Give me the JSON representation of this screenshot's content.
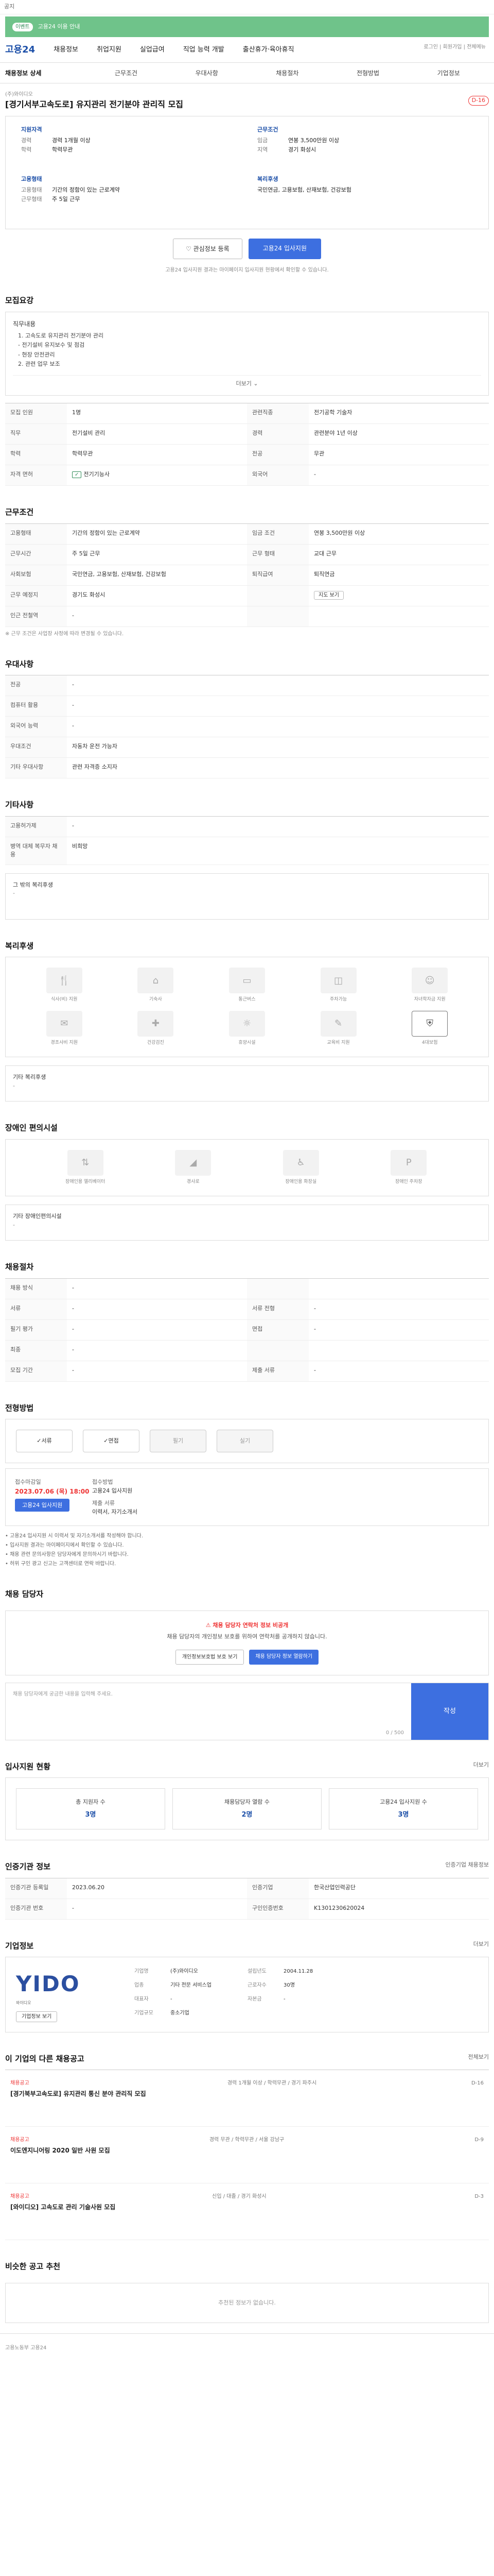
{
  "topbar": {
    "text": "공지"
  },
  "banner": {
    "tag": "이벤트",
    "text": "고용24 이용 안내"
  },
  "nav": {
    "logo": "고용24",
    "items": [
      "채용정보",
      "취업지원",
      "실업급여",
      "직업 능력 개발",
      "출산휴가·육아휴직"
    ]
  },
  "util": {
    "text": "로그인 | 회원가입 | 전체메뉴"
  },
  "subtabs": [
    "채용정보 상세",
    "근무조건",
    "우대사항",
    "채용절차",
    "전형방법",
    "기업정보"
  ],
  "job": {
    "company_tag": "(주)와이디오",
    "title": "[경기서부고속도로] 유지관리 전기분야 관리직 모집",
    "dday": "D-16",
    "summary": {
      "left_label": "지원자격",
      "left_rows": [
        {
          "k": "경력",
          "v": "경력 1개월 이상"
        },
        {
          "k": "학력",
          "v": "학력무관"
        }
      ],
      "left_label2": "고용형태",
      "left_rows2": [
        {
          "k": "고용형태",
          "v": "기간의 정함이 있는 근로계약"
        },
        {
          "k": "근무형태",
          "v": "주 5일 근무"
        }
      ],
      "right_label": "근무조건",
      "right_rows": [
        {
          "k": "임금",
          "v": "연봉 3,500만원 이상"
        },
        {
          "k": "지역",
          "v": "경기 화성시"
        }
      ],
      "right_label2": "복리후생",
      "right_rows2": [
        {
          "k": "",
          "v": "국민연금, 고용보험, 산재보험, 건강보험"
        }
      ]
    },
    "save_label": "관심정보 등록",
    "apply_label": "고용24 입사지원",
    "note": "고용24 입사지원 결과는 마이페이지 입사지원 현황에서 확인할 수 있습니다."
  },
  "detail": {
    "title": "모집요강",
    "duty_head": "직무내용",
    "duties": [
      "1. 고속도로 유지관리 전기분야 관리",
      "  - 전기설비 유지보수 및 점검",
      "  - 현장 안전관리",
      "2. 관련 업무 보조"
    ],
    "toggle": "더보기",
    "rows": [
      {
        "k": "모집 인원",
        "v": "1명",
        "k2": "관련직종",
        "v2": "전기공학 기술자"
      },
      {
        "k": "직무",
        "v": "전기설비 관리",
        "k2": "경력",
        "v2": "관련분야 1년 이상"
      },
      {
        "k": "학력",
        "v": "학력무관",
        "k2": "전공",
        "v2": "무관"
      },
      {
        "k": "자격 면허",
        "v": "전기기능사",
        "k2": "외국어",
        "v2": "-"
      }
    ]
  },
  "conditions": {
    "title": "근무조건",
    "rows": [
      {
        "k": "고용형태",
        "v": "기간의 정함이 있는 근로계약",
        "k2": "임금 조건",
        "v2": "연봉 3,500만원 이상"
      },
      {
        "k": "근무시간",
        "v": "주 5일 근무",
        "k2": "근무 형태",
        "v2": "교대 근무"
      },
      {
        "k": "사회보험",
        "v": "국민연금, 고용보험, 산재보험, 건강보험",
        "k2": "퇴직급여",
        "v2": "퇴직연금"
      },
      {
        "k": "근무 예정지",
        "v": "경기도 화성시",
        "k2": "",
        "v2": ""
      },
      {
        "k": "인근 전철역",
        "v": "-",
        "k2": "",
        "v2": ""
      }
    ],
    "map_label": "지도 보기",
    "footnote": "※ 근무 조건은 사업장 사정에 따라 변경될 수 있습니다."
  },
  "prefs": {
    "title": "우대사항",
    "rows": [
      {
        "k": "전공",
        "v": "-"
      },
      {
        "k": "컴퓨터 활용",
        "v": "-"
      },
      {
        "k": "외국어 능력",
        "v": "-"
      },
      {
        "k": "우대조건",
        "v": "자동차 운전 가능자"
      },
      {
        "k": "기타 우대사항",
        "v": "관련 자격증 소지자"
      }
    ]
  },
  "other": {
    "title": "기타사항",
    "rows": [
      {
        "k": "고용허가제",
        "v": "-"
      },
      {
        "k": "병역 대체 복무자 채용",
        "v": "비희망"
      }
    ],
    "extra": "그 밖의 복리후생",
    "extra_v": "-"
  },
  "welfare": {
    "title": "복리후생",
    "items": [
      {
        "icon": "meal-icon",
        "label": "식사(비) 지원",
        "on": false
      },
      {
        "icon": "dorm-icon",
        "label": "기숙사",
        "on": false
      },
      {
        "icon": "bus-icon",
        "label": "통근버스",
        "on": false
      },
      {
        "icon": "car-icon",
        "label": "주차가능",
        "on": false
      },
      {
        "icon": "child-icon",
        "label": "자녀학자금 지원",
        "on": false
      },
      {
        "icon": "gift-icon",
        "label": "경조사비 지원",
        "on": false
      },
      {
        "icon": "health-icon",
        "label": "건강검진",
        "on": false
      },
      {
        "icon": "rest-icon",
        "label": "휴양시설",
        "on": false
      },
      {
        "icon": "edu-icon",
        "label": "교육비 지원",
        "on": false
      },
      {
        "icon": "insurance-icon",
        "label": "4대보험",
        "on": true
      }
    ],
    "extra": "기타 복리후생",
    "extra_v": "-"
  },
  "facility": {
    "title": "장애인 편의시설",
    "items": [
      {
        "icon": "elevator-icon",
        "label": "장애인용 엘리베이터"
      },
      {
        "icon": "ramp-icon",
        "label": "경사로"
      },
      {
        "icon": "toilet-icon",
        "label": "장애인용 화장실"
      },
      {
        "icon": "parking-icon",
        "label": "장애인 주차장"
      }
    ],
    "extra": "기타 장애인편의시설",
    "extra_v": "-"
  },
  "hiring": {
    "title": "채용절차",
    "rows": [
      {
        "k": "채용 방식",
        "v": "-",
        "k2": "",
        "v2": ""
      },
      {
        "k": "서류",
        "v": "-",
        "k2": "서류 전형",
        "v2": "-"
      },
      {
        "k": "필기 평가",
        "v": "-",
        "k2": "면접",
        "v2": "-"
      },
      {
        "k": "최종",
        "v": "-",
        "k2": "",
        "v2": ""
      },
      {
        "k": "모집 기간",
        "v": "-",
        "k2": "제출 서류",
        "v2": "-"
      }
    ]
  },
  "process": {
    "title": "전형방법",
    "steps": [
      {
        "label": "서류",
        "on": true
      },
      {
        "label": "면접",
        "on": true
      },
      {
        "label": "필기",
        "on": false
      },
      {
        "label": "실기",
        "on": false
      }
    ],
    "period_label": "접수마감일",
    "period_value": "2023.07.06 (목) 18:00",
    "method_label": "접수방법",
    "method_value": "고용24 입사지원",
    "doc_label": "제출 서류",
    "doc_value": "이력서, 자기소개서",
    "apply_btn": "고용24 입사지원",
    "bullets": [
      "• 고용24 입사지원 시 이력서 및 자기소개서를 작성해야 합니다.",
      "• 입사지원 결과는 마이페이지에서 확인할 수 있습니다.",
      "• 채용 관련 문의사항은 담당자에게 문의하시기 바랍니다.",
      "• 허위 구인 광고 신고는 고객센터로 연락 바랍니다."
    ]
  },
  "contact": {
    "title": "채용 담당자",
    "warn1": "채용 담당자 연락처 정보 비공개",
    "warn2": "채용 담당자의 개인정보 보호를 위하여 연락처를 공개하지 않습니다.",
    "btn1": "개인정보보호법 보호 보기",
    "btn2": "채용 담당자 정보 열람하기",
    "qa_placeholder": "채용 담당자에게 궁금한 내용을 입력해 주세요.",
    "qa_count": "0 / 500",
    "qa_send": "작성"
  },
  "stats": {
    "title": "입사지원 현황",
    "more": "더보기",
    "items": [
      {
        "label": "총 지원자 수",
        "value": "3명"
      },
      {
        "label": "채용담당자 열람 수",
        "value": "2명"
      },
      {
        "label": "고용24 입사지원 수",
        "value": "3명"
      }
    ]
  },
  "history": {
    "title": "인증기관 정보",
    "badge": "인증기업 채용정보",
    "rows": [
      {
        "k": "인증기관 등록일",
        "v": "2023.06.20",
        "k2": "인증기업",
        "v2": "한국산업인력공단"
      },
      {
        "k": "인증기관 번호",
        "v": "-",
        "k2": "구인인증번호",
        "v2": "K1301230620024"
      }
    ]
  },
  "company": {
    "title": "기업정보",
    "more": "더보기",
    "brand": "YIDO",
    "brand_sub": "와이디오",
    "btn": "기업정보 보기",
    "rows": [
      {
        "k": "기업명",
        "v": "(주)와이디오",
        "k2": "설립년도",
        "v2": "2004.11.28"
      },
      {
        "k": "업종",
        "v": "기타 전문 서비스업",
        "k2": "근로자수",
        "v2": "30명"
      },
      {
        "k": "대표자",
        "v": "-",
        "k2": "자본금",
        "v2": "-"
      },
      {
        "k": "기업규모",
        "v": "중소기업",
        "k2": "",
        "v2": ""
      }
    ]
  },
  "joblist": {
    "title": "이 기업의 다른 채용공고",
    "more": "전체보기",
    "jobs": [
      {
        "co": "채용공고",
        "title": "[경기북부고속도로] 유지관리 통신 분야 관리직 모집",
        "det": "경력 1개월 이상 / 학력무관 / 경기 파주시",
        "side": "D-16"
      },
      {
        "co": "채용공고",
        "title": "이도엔지니어링 2020 일반 사원 모집",
        "det": "경력 무관 / 학력무관 / 서울 강남구",
        "side": "D-9"
      },
      {
        "co": "채용공고",
        "title": "[와이디오] 고속도로 관리 기술사원 모집",
        "det": "신입 / 대졸 / 경기 화성시",
        "side": "D-3"
      }
    ]
  },
  "ai": {
    "title": "비슷한 공고 추천",
    "text": "추천된 정보가 없습니다."
  },
  "footer": {
    "text": "고용노동부 고용24"
  }
}
